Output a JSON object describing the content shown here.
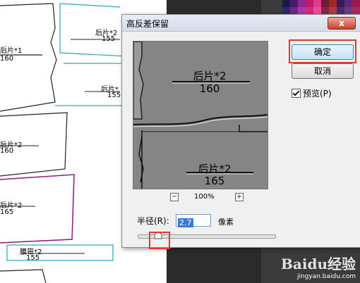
{
  "background": {
    "pieces": [
      {
        "name": "后片*1",
        "size": "160"
      },
      {
        "name": "后片*2",
        "size": "155"
      },
      {
        "name": "后片*",
        "size": "155"
      },
      {
        "name": "后片*2",
        "size": "160"
      },
      {
        "name": "后片*2",
        "size": "165"
      },
      {
        "name": "腰带*2",
        "size": "155"
      }
    ],
    "watermark": {
      "logo": "Baidu经验",
      "url": "jingyan.baidu.com"
    }
  },
  "dialog": {
    "title": "高反差保留",
    "close_label": "x",
    "preview_texts": [
      {
        "name": "后片*2",
        "size": "160"
      },
      {
        "name": "后片*2",
        "size": "165"
      }
    ],
    "zoom_out": "−",
    "zoom_level": "100%",
    "zoom_in": "+",
    "radius_label": "半径(R):",
    "radius_value": "2.7",
    "radius_unit": "像素",
    "ok_label": "确定",
    "cancel_label": "取消",
    "preview_label": "预览(P)",
    "preview_checked": true
  },
  "colors": {
    "highlight": "#e03a2e",
    "teal": "#2aa7b5",
    "purple": "#8b1a7a"
  }
}
